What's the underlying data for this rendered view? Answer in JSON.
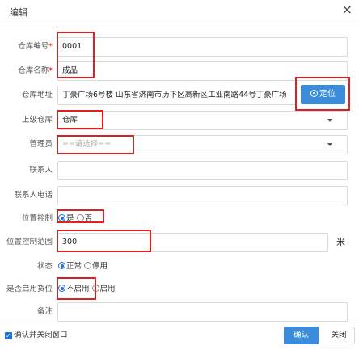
{
  "dialog": {
    "title": "编辑",
    "close_icon": "×"
  },
  "form": {
    "code": {
      "label": "仓库编号",
      "required_mark": "*",
      "value": "0001"
    },
    "name": {
      "label": "仓库名称",
      "required_mark": "*",
      "value": "成品"
    },
    "address": {
      "label": "仓库地址",
      "value": "丁豪广场6号楼 山东省济南市历下区高新区工业南路44号丁豪广场",
      "locate_label": "定位"
    },
    "parent": {
      "label": "上级仓库",
      "value": "仓库"
    },
    "manager": {
      "label": "管理员",
      "placeholder": "==请选择=="
    },
    "contact": {
      "label": "联系人",
      "value": ""
    },
    "phone": {
      "label": "联系人电话",
      "value": ""
    },
    "location_control": {
      "label": "位置控制",
      "options": [
        "是",
        "否"
      ],
      "selected": "是"
    },
    "location_range": {
      "label": "位置控制范围",
      "value": "300",
      "unit": "米"
    },
    "status": {
      "label": "状态",
      "options": [
        "正常",
        "停用"
      ],
      "selected": "正常"
    },
    "enable_slot": {
      "label": "是否启用货位",
      "options": [
        "不启用",
        "启用"
      ],
      "selected": "不启用"
    },
    "remark": {
      "label": "备注",
      "value": ""
    }
  },
  "footer": {
    "confirm_close_label": "确认并关闭窗口",
    "confirm_label": "确认",
    "close_label": "关闭"
  },
  "colors": {
    "primary": "#3c8cdc",
    "highlight": "#e02020",
    "radio": "#1e6fd9"
  }
}
